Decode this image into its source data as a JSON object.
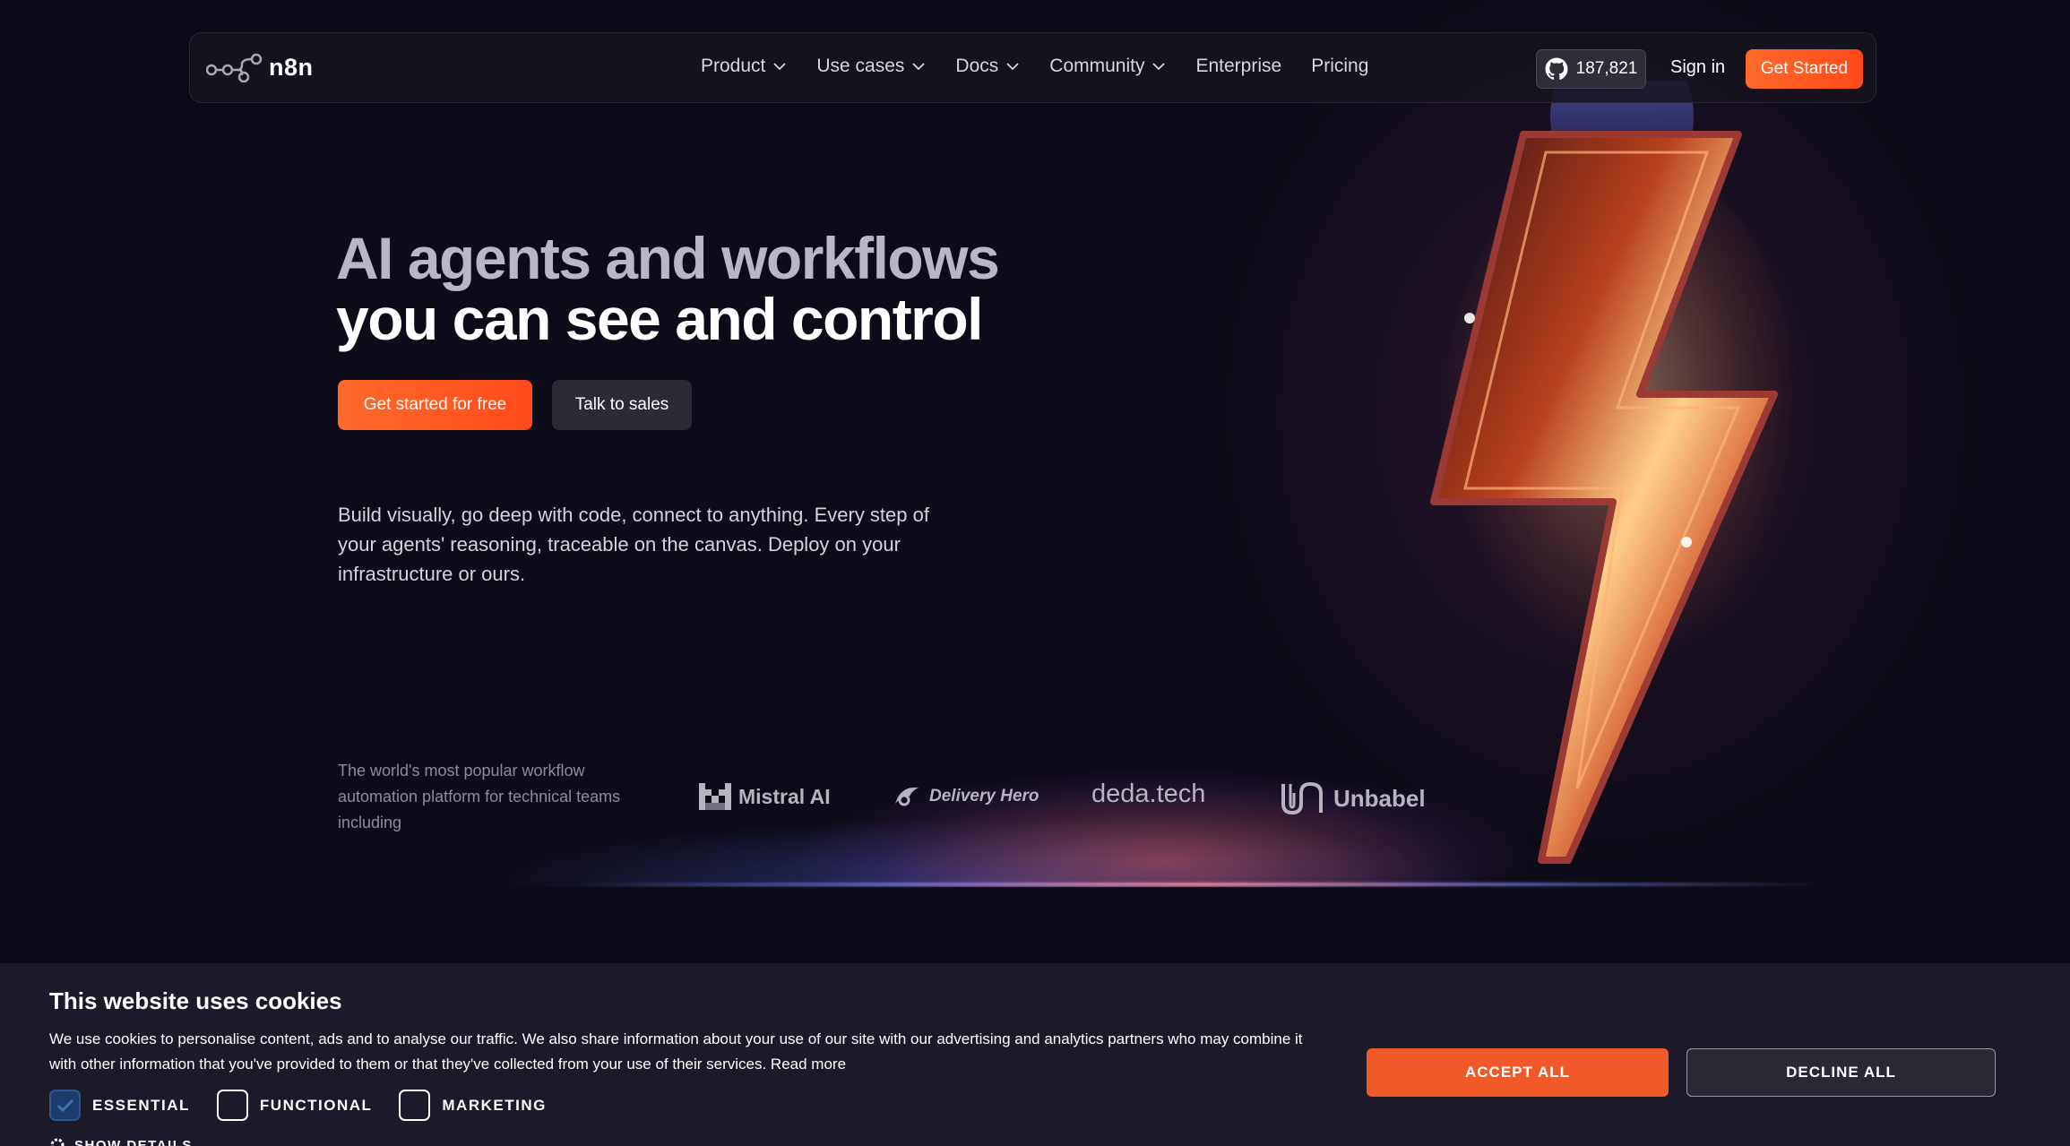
{
  "nav": {
    "logo_text": "n8n",
    "items": [
      {
        "label": "Product",
        "has_dropdown": true
      },
      {
        "label": "Use cases",
        "has_dropdown": true
      },
      {
        "label": "Docs",
        "has_dropdown": true
      },
      {
        "label": "Community",
        "has_dropdown": true
      },
      {
        "label": "Enterprise",
        "has_dropdown": false
      },
      {
        "label": "Pricing",
        "has_dropdown": false
      }
    ],
    "github_stars": "187,821",
    "signin_label": "Sign in",
    "get_started_label": "Get Started"
  },
  "hero": {
    "title_line1": "AI agents and workflows",
    "title_line2": "you can see and control",
    "primary_cta": "Get started for free",
    "secondary_cta": "Talk to sales",
    "lead": "Build visually, go deep with code, connect to anything. Every step of your agents' reasoning, traceable on the canvas. Deploy on your infrastructure or ours.",
    "tagline": "The world's most popular workflow automation platform for technical teams including",
    "logos": [
      "Mistral AI",
      "Delivery Hero",
      "deda.tech",
      "Unbabel"
    ]
  },
  "cookie": {
    "title": "This website uses cookies",
    "text": "We use cookies to personalise content, ads and to analyse our traffic. We also share information about your use of our site with our advertising and analytics partners who may combine it with other information that you've provided to them or that they've collected from your use of their services. Read more",
    "options": [
      {
        "label": "ESSENTIAL",
        "checked": true
      },
      {
        "label": "FUNCTIONAL",
        "checked": false
      },
      {
        "label": "MARKETING",
        "checked": false
      }
    ],
    "show_details": "SHOW DETAILS",
    "accept_label": "ACCEPT ALL",
    "decline_label": "DECLINE ALL"
  },
  "colors": {
    "background": "#0d0b17",
    "accent": "#ff5a24",
    "cookie_bg": "#1c1a28"
  }
}
